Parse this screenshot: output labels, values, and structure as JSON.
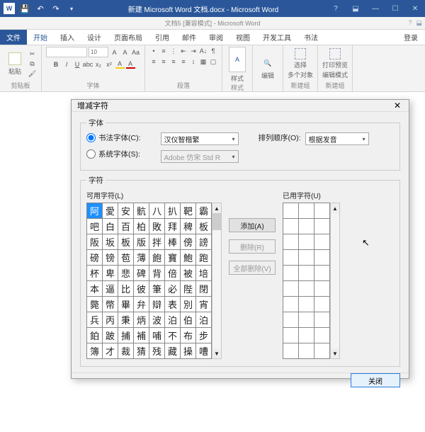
{
  "titlebar": {
    "doc_title": "新建 Microsoft Word 文档.docx - Microsoft Word"
  },
  "subtitle": {
    "text": "文档5 [兼容模式] - Microsoft Word"
  },
  "tabs": {
    "file": "文件",
    "items": [
      "开始",
      "插入",
      "设计",
      "页面布局",
      "引用",
      "邮件",
      "审阅",
      "视图",
      "开发工具",
      "书法"
    ],
    "active_index": 0,
    "login": "登录"
  },
  "ribbon": {
    "clipboard": {
      "paste": "粘贴",
      "label": "剪贴板"
    },
    "font": {
      "size": "10",
      "label": "字体"
    },
    "para": {
      "label": "段落"
    },
    "style": {
      "btn": "样式",
      "label": "样式"
    },
    "edit": {
      "btn": "编辑"
    },
    "g1": {
      "a": "选择",
      "b": "多个对象",
      "c": "新建组"
    },
    "g2": {
      "a": "打印预览",
      "b": "编辑模式",
      "c": "新建组"
    }
  },
  "dialog": {
    "title": "增减字符",
    "close": "✕",
    "fieldset_font": "字体",
    "radio_calli": "书法字体(C):",
    "radio_sys": "系统字体(S):",
    "dd_calli": "汉仪智楷繁",
    "dd_sys": "Adobe 仿宋 Std R",
    "sort_label": "排列顺序(O):",
    "sort_value": "根据发音",
    "fieldset_chars": "字符",
    "avail_label": "可用字符(L)",
    "used_label": "已用字符(U)",
    "btn_add": "添加(A)",
    "btn_del": "删除(R)",
    "btn_delall": "全部删除(V)",
    "btn_close": "关闭",
    "chars": [
      "阿",
      "愛",
      "安",
      "骯",
      "八",
      "扒",
      "靶",
      "霸",
      "吧",
      "白",
      "百",
      "柏",
      "敗",
      "拜",
      "稗",
      "板",
      "阪",
      "坂",
      "板",
      "版",
      "拌",
      "棒",
      "傍",
      "謗",
      "磅",
      "镑",
      "苞",
      "薄",
      "飽",
      "寶",
      "鮑",
      "跑",
      "杯",
      "卑",
      "悲",
      "碑",
      "背",
      "倍",
      "被",
      "培",
      "本",
      "逼",
      "比",
      "彼",
      "筆",
      "必",
      "陛",
      "閉",
      "斃",
      "幣",
      "畢",
      "弁",
      "辯",
      "表",
      "別",
      "宵",
      "兵",
      "丙",
      "秉",
      "炳",
      "波",
      "泊",
      "伯",
      "泊",
      "鉑",
      "跛",
      "捕",
      "補",
      "哺",
      "不",
      "布",
      "步",
      "簿",
      "才",
      "裁",
      "猜",
      "残",
      "藏",
      "操",
      "嘈"
    ]
  }
}
